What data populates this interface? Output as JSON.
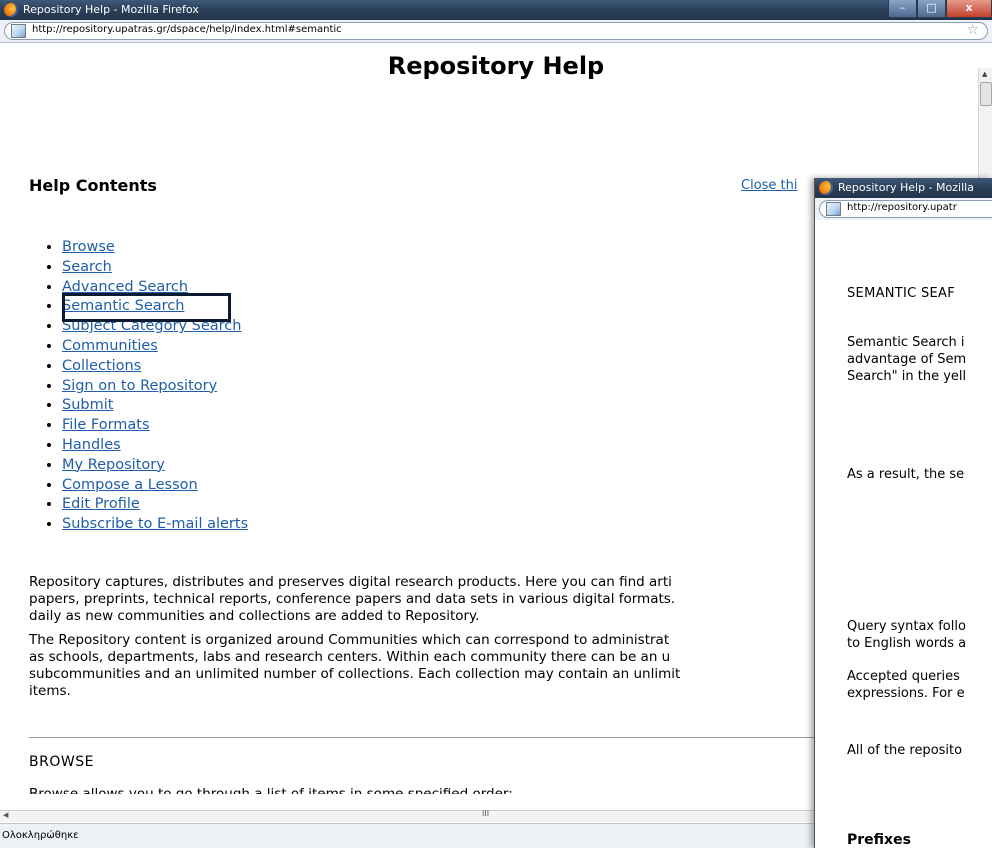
{
  "main": {
    "window_title": "Repository Help - Mozilla Firefox",
    "url": "http://repository.upatras.gr/dspace/help/index.html#semantic",
    "page_title": "Repository Help",
    "help_contents": "Help Contents",
    "close_link": "Close thi",
    "toc": [
      "Browse",
      "Search",
      "Advanced Search",
      "Semantic Search",
      "Subject Category Search",
      "Communities",
      "Collections",
      "Sign on to Repository",
      "Submit",
      "File Formats",
      "Handles",
      "My Repository",
      "Compose a Lesson",
      "Edit Profile",
      "Subscribe to E-mail alerts"
    ],
    "para1": "Repository captures, distributes and preserves digital research products. Here you can find arti\npapers, preprints, technical reports, conference papers and data sets in various digital formats.\ndaily as new communities and collections are added to Repository.",
    "para2": "The Repository content is organized around Communities which can correspond to administrat\nas schools, departments, labs and research centers. Within each community there can be an u\nsubcommunities and an unlimited number of collections. Each collection may contain an unlimit\nitems.",
    "browse_heading": "BROWSE",
    "browse_line": "Browse allows you to go through a list of items in some specified order:",
    "status": "Ολοκληρώθηκε",
    "win_buttons": [
      "–",
      "□",
      "x"
    ]
  },
  "secondary": {
    "window_title": "Repository Help - Mozilla",
    "url": "http://repository.upatr",
    "heading": "SEMANTIC SEAF",
    "lines": [
      "Semantic Search i",
      "advantage of Sem",
      "Search\" in the yell",
      "As a result, the se",
      "Query syntax follo",
      "to English words a",
      "Accepted queries",
      "expressions. For e",
      "All of the reposito",
      "Prefixes"
    ]
  }
}
